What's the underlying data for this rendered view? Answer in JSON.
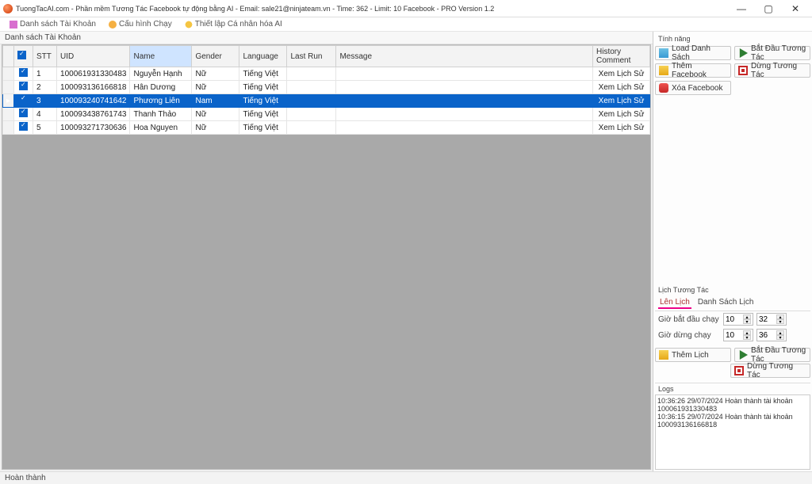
{
  "window": {
    "title": "TuongTacAI.com - Phần mềm Tương Tác Facebook tự động bằng AI - Email: sale21@ninjateam.vn - Time: 362 - Limit: 10 Facebook - PRO Version 1.2"
  },
  "tabs": [
    {
      "label": "Danh sách Tài Khoản"
    },
    {
      "label": "Cấu hình Chạy"
    },
    {
      "label": "Thiết lập Cá nhân hóa AI"
    }
  ],
  "accounts_panel": {
    "title": "Danh sách Tài Khoản",
    "columns": [
      "",
      "",
      "STT",
      "UID",
      "Name",
      "Gender",
      "Language",
      "Last Run",
      "Message",
      "History Comment"
    ],
    "rows": [
      {
        "stt": "1",
        "uid": "100061931330483",
        "name": "Nguyễn Hạnh",
        "gender": "Nữ",
        "lang": "Tiếng Việt",
        "run": "",
        "msg": "",
        "hist": "Xem Lịch Sử",
        "sel": false
      },
      {
        "stt": "2",
        "uid": "100093136166818",
        "name": "Hân Dương",
        "gender": "Nữ",
        "lang": "Tiếng Việt",
        "run": "",
        "msg": "",
        "hist": "Xem Lịch Sử",
        "sel": false
      },
      {
        "stt": "3",
        "uid": "100093240741642",
        "name": "Phương Liên",
        "gender": "Nam",
        "lang": "Tiếng Việt",
        "run": "",
        "msg": "",
        "hist": "Xem Lịch Sử",
        "sel": true
      },
      {
        "stt": "4",
        "uid": "100093438761743",
        "name": "Thanh Thảo",
        "gender": "Nữ",
        "lang": "Tiếng Việt",
        "run": "",
        "msg": "",
        "hist": "Xem Lịch Sử",
        "sel": false
      },
      {
        "stt": "5",
        "uid": "100093271730636",
        "name": "Hoa Nguyen",
        "gender": "Nữ",
        "lang": "Tiếng Việt",
        "run": "",
        "msg": "",
        "hist": "Xem Lịch Sử",
        "sel": false
      }
    ]
  },
  "features": {
    "title": "Tính năng",
    "load": "Load Danh Sách",
    "add": "Thêm Facebook",
    "del": "Xóa Facebook",
    "start": "Bắt Đầu Tương Tác",
    "stop": "Dừng Tương Tác"
  },
  "schedule": {
    "title": "Lịch Tương Tác",
    "tab1": "Lên Lịch",
    "tab2": "Danh Sách Lịch",
    "start_label": "Giờ bắt đầu chạy",
    "stop_label": "Giờ dừng chạy",
    "start_h": "10",
    "start_m": "32",
    "stop_h": "10",
    "stop_m": "36",
    "add_sched": "Thêm Lịch",
    "start": "Bắt Đầu Tương Tác",
    "stop": "Dừng Tương Tác"
  },
  "logs": {
    "title": "Logs",
    "lines": [
      "10:36:26 29/07/2024 Hoàn thành tài khoản 100061931330483",
      "10:36:15 29/07/2024 Hoàn thành tài khoản 100093136166818"
    ]
  },
  "status": "Hoàn thành"
}
